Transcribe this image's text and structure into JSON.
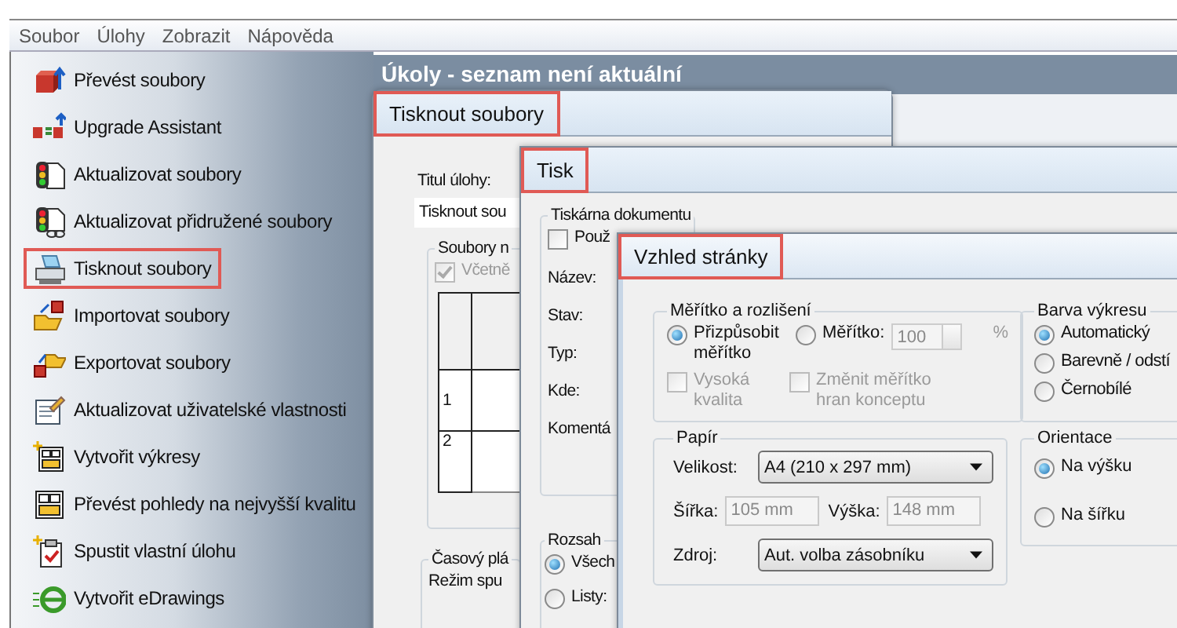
{
  "menu_bar": [
    {
      "label": "Soubor"
    },
    {
      "label": "Úlohy"
    },
    {
      "label": "Zobrazit"
    },
    {
      "label": "Nápověda"
    }
  ],
  "sidebar": {
    "items": [
      {
        "label": "Převést soubory",
        "highlighted": false
      },
      {
        "label": "Upgrade Assistant",
        "highlighted": false
      },
      {
        "label": "Aktualizovat soubory",
        "highlighted": false
      },
      {
        "label": "Aktualizovat přidružené soubory",
        "highlighted": false
      },
      {
        "label": "Tisknout soubory",
        "highlighted": true
      },
      {
        "label": "Importovat soubory",
        "highlighted": false
      },
      {
        "label": "Exportovat soubory",
        "highlighted": false
      },
      {
        "label": "Aktualizovat uživatelské vlastnosti",
        "highlighted": false
      },
      {
        "label": "Vytvořit výkresy",
        "highlighted": false
      },
      {
        "label": "Převést pohledy na nejvyšší kvalitu",
        "highlighted": false
      },
      {
        "label": "Spustit vlastní úlohu",
        "highlighted": false
      },
      {
        "label": "Vytvořit eDrawings",
        "highlighted": false
      }
    ]
  },
  "header": {
    "title": "Úkoly - seznam není aktuální"
  },
  "windows": [
    {
      "title": "Tisknout soubory",
      "highlighted": true,
      "items": [
        {
          "kind": "label",
          "text": "Titul úlohy:"
        },
        {
          "kind": "field",
          "value": "Tisknout sou",
          "disabled": false
        },
        {
          "kind": "group",
          "label": "Soubory n",
          "items": [
            {
              "kind": "checkbox",
              "label": "Včetně",
              "checked": true,
              "disabled": true
            },
            {
              "kind": "grid",
              "rows": [
                "1",
                "2"
              ]
            }
          ]
        },
        {
          "kind": "group",
          "label": "Časový plá",
          "items": [
            {
              "kind": "label",
              "text": "Režim spu"
            }
          ]
        }
      ]
    },
    {
      "title": "Tisk",
      "highlighted": true,
      "items": [
        {
          "kind": "group",
          "label": "Tiskárna dokumentu",
          "items": [
            {
              "kind": "checkbox",
              "label": "Použ",
              "checked": false,
              "disabled": false
            },
            {
              "kind": "label",
              "text": "Název:"
            },
            {
              "kind": "label",
              "text": "Stav:"
            },
            {
              "kind": "label",
              "text": "Typ:"
            },
            {
              "kind": "label",
              "text": "Kde:"
            },
            {
              "kind": "label",
              "text": "Komentá"
            }
          ]
        },
        {
          "kind": "group",
          "label": "Rozsah",
          "items": [
            {
              "kind": "radio",
              "label": "Všech",
              "selected": true
            },
            {
              "kind": "radio",
              "label": "Listy:",
              "selected": false
            }
          ]
        }
      ]
    },
    {
      "title": "Vzhled stránky",
      "highlighted": true,
      "items": [
        {
          "kind": "group",
          "label": "Měřítko a rozlišení",
          "items": [
            {
              "kind": "row",
              "items": [
                {
                  "kind": "radio",
                  "label": "Přizpůsobit měřítko",
                  "selected": true
                },
                {
                  "kind": "radio",
                  "label": "Měřítko:",
                  "selected": false
                },
                {
                  "kind": "spin",
                  "value": "100",
                  "disabled": true
                },
                {
                  "kind": "label",
                  "text": "%",
                  "disabled": true
                }
              ]
            },
            {
              "kind": "row",
              "items": [
                {
                  "kind": "checkbox",
                  "label": "Vysoká kvalita",
                  "checked": false,
                  "disabled": true
                },
                {
                  "kind": "checkbox",
                  "label": "Změnit měřítko hran konceptu",
                  "checked": false,
                  "disabled": true
                }
              ]
            }
          ]
        },
        {
          "kind": "group",
          "label": "Barva výkresu",
          "items": [
            {
              "kind": "radio",
              "label": "Automatický",
              "selected": true
            },
            {
              "kind": "radio",
              "label": "Barevně / odstí",
              "selected": false
            },
            {
              "kind": "radio",
              "label": "Černobílé",
              "selected": false
            }
          ]
        },
        {
          "kind": "group",
          "label": "Papír",
          "items": [
            {
              "kind": "select",
              "label": "Velikost:",
              "value": "A4 (210 x 297 mm)"
            },
            {
              "kind": "row",
              "items": [
                {
                  "kind": "label",
                  "text": "Šířka:"
                },
                {
                  "kind": "field",
                  "value": "105 mm",
                  "disabled": true
                },
                {
                  "kind": "label",
                  "text": "Výška:"
                },
                {
                  "kind": "field",
                  "value": "148 mm",
                  "disabled": true
                }
              ]
            },
            {
              "kind": "select",
              "label": "Zdroj:",
              "value": "Aut. volba zásobníku"
            }
          ]
        },
        {
          "kind": "group",
          "label": "Orientace",
          "items": [
            {
              "kind": "radio",
              "label": "Na výšku",
              "selected": true
            },
            {
              "kind": "radio",
              "label": "Na šířku",
              "selected": false
            }
          ]
        }
      ]
    }
  ]
}
